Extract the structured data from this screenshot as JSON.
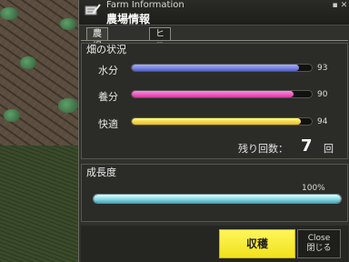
{
  "window": {
    "title_en": "Farm Information",
    "title_jp": "農場情報",
    "minimize_glyph": "▪",
    "close_glyph": "✕"
  },
  "tabs": [
    {
      "label": "農場管理",
      "active": true
    },
    {
      "label": "ヒストリー",
      "active": false
    }
  ],
  "field_status": {
    "title": "畑の状況",
    "rows": [
      {
        "label": "水分",
        "value": 93,
        "display": "93",
        "color": "#5561c8"
      },
      {
        "label": "養分",
        "value": 90,
        "display": "90",
        "color": "#d93a9a"
      },
      {
        "label": "快適",
        "value": 94,
        "display": "94",
        "color": "#e8b72a"
      }
    ],
    "remaining_label": "残り回数：",
    "remaining_count": "7",
    "remaining_unit": "回"
  },
  "growth": {
    "title": "成長度",
    "value": 100,
    "display": "100%",
    "color": "#7fd6e3"
  },
  "buttons": {
    "harvest_label": "収穫",
    "harvest_color": "#f7eb2e",
    "close_label_en": "Close",
    "close_label_jp": "閉じる"
  },
  "icons": {
    "title_icon": "notepad-pen-icon"
  }
}
